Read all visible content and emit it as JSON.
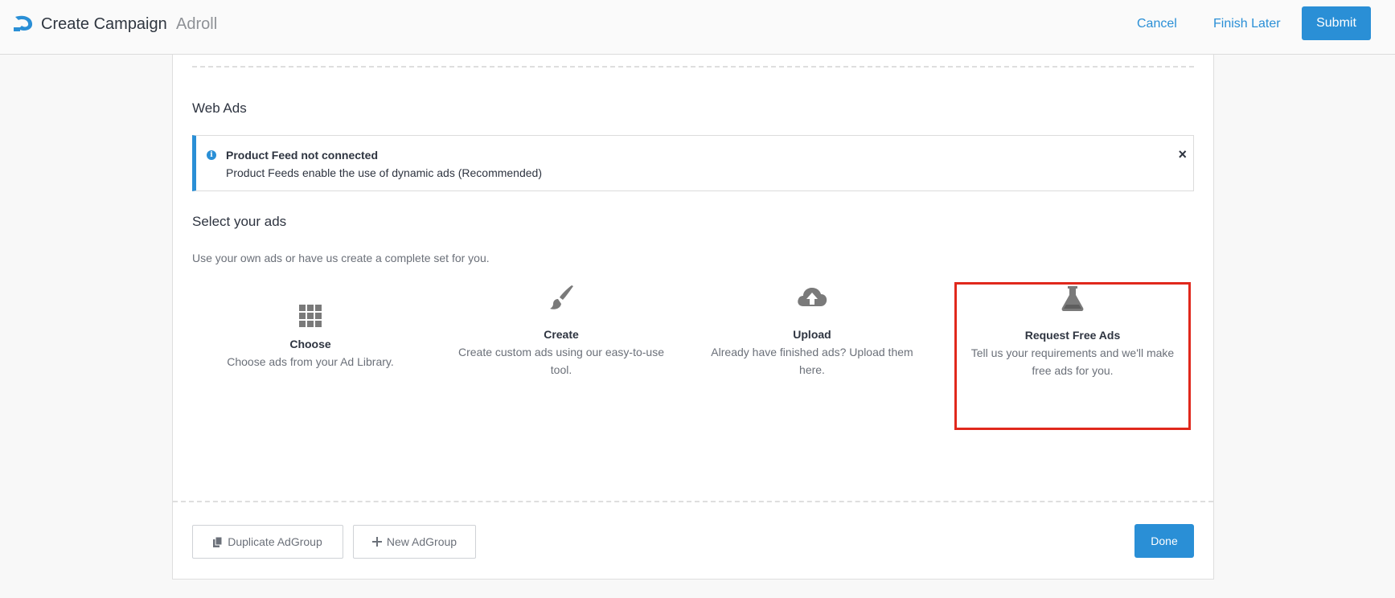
{
  "header": {
    "title": "Create Campaign",
    "subtitle": "Adroll",
    "cancel_label": "Cancel",
    "finish_later_label": "Finish Later",
    "submit_label": "Submit",
    "logo_icon": "adroll-logo-icon"
  },
  "section": {
    "title": "Web Ads"
  },
  "notice": {
    "icon": "info-icon",
    "title": "Product Feed not connected",
    "description": "Product Feeds enable the use of dynamic ads (Recommended)",
    "close_label": "×"
  },
  "select_ads": {
    "title": "Select your ads",
    "description": "Use your own ads or have us create a complete set for you.",
    "options": [
      {
        "icon": "grid-icon",
        "name": "Choose",
        "description": "Choose ads from your Ad Library."
      },
      {
        "icon": "paintbrush-icon",
        "name": "Create",
        "description": "Create custom ads using our easy-to-use tool."
      },
      {
        "icon": "cloud-upload-icon",
        "name": "Upload",
        "description": "Already have finished ads? Upload them here."
      },
      {
        "icon": "flask-icon",
        "name": "Request Free Ads",
        "description": "Tell us your requirements and we'll make free ads for you."
      }
    ]
  },
  "footer": {
    "duplicate_label": "Duplicate AdGroup",
    "new_label": "New AdGroup",
    "done_label": "Done"
  },
  "colors": {
    "accent": "#2a8fd6",
    "highlight": "#e0281c",
    "icon": "#7a7a7a"
  }
}
